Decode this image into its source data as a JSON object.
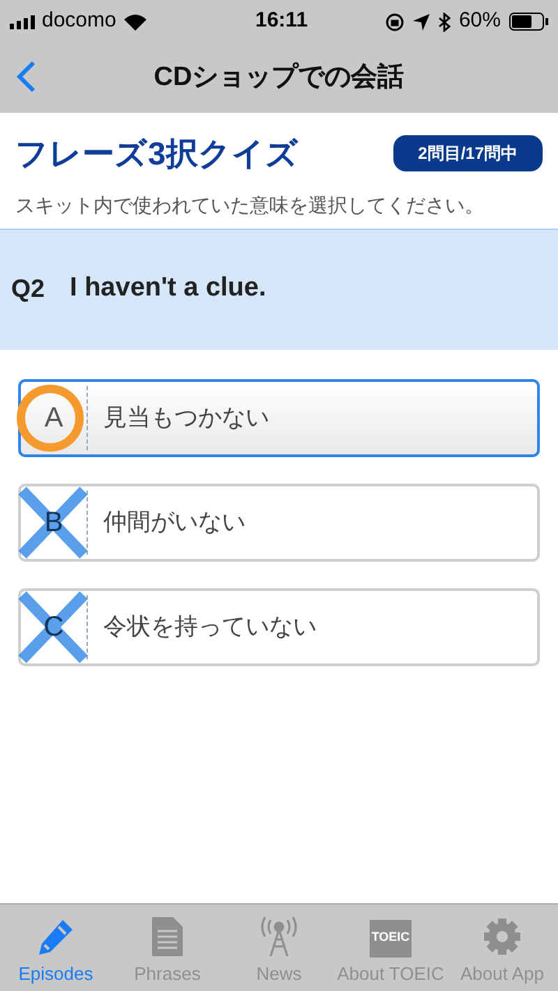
{
  "status_bar": {
    "carrier": "docomo",
    "time": "16:11",
    "battery": "60%"
  },
  "nav_bar": {
    "title": "CDショップでの会話"
  },
  "quiz": {
    "title": "フレーズ3択クイズ",
    "progress": "2問目/17問中",
    "instruction": "スキット内で使われていた意味を選択してください。",
    "question_number": "Q2",
    "question": "I haven't a clue."
  },
  "options": [
    {
      "letter": "A",
      "text": "見当もつかない",
      "selected": true,
      "eliminated": false
    },
    {
      "letter": "B",
      "text": "仲間がいない",
      "selected": false,
      "eliminated": true
    },
    {
      "letter": "C",
      "text": "令状を持っていない",
      "selected": false,
      "eliminated": true
    }
  ],
  "tab_bar": [
    {
      "kind": "pencil",
      "label": "Episodes",
      "selected": true
    },
    {
      "kind": "document",
      "label": "Phrases",
      "selected": false
    },
    {
      "kind": "antenna",
      "label": "News",
      "selected": false
    },
    {
      "kind": "badge",
      "label": "About TOEIC",
      "icon_text": "TOEIC",
      "selected": false
    },
    {
      "kind": "gear",
      "label": "About App",
      "selected": false
    }
  ]
}
